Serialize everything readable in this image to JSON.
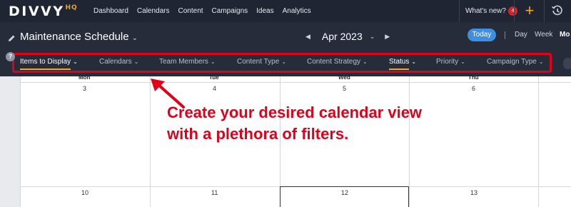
{
  "app": {
    "logo_text": "DIVVY",
    "logo_sup": "HQ"
  },
  "nav": {
    "links": [
      "Dashboard",
      "Calendars",
      "Content",
      "Campaigns",
      "Ideas",
      "Analytics"
    ],
    "whats_new": "What's new?",
    "whats_new_count": "4",
    "plus_icon": "plus-icon",
    "history_icon": "history-icon"
  },
  "header": {
    "board_title": "Maintenance Schedule",
    "month": "Apr 2023",
    "today_label": "Today",
    "views": [
      "Day",
      "Week",
      "Mo"
    ],
    "separator": "|"
  },
  "filters": [
    {
      "label": "Items to Display",
      "active": true
    },
    {
      "label": "Calendars",
      "active": false
    },
    {
      "label": "Team Members",
      "active": false
    },
    {
      "label": "Content Type",
      "active": false
    },
    {
      "label": "Content Strategy",
      "active": false
    },
    {
      "label": "Status",
      "active": true
    },
    {
      "label": "Priority",
      "active": false
    },
    {
      "label": "Campaign Type",
      "active": false
    }
  ],
  "calendar": {
    "weekdays": [
      "Mon",
      "Tue",
      "Wed",
      "Thu"
    ],
    "week1": [
      "3",
      "4",
      "5",
      "6"
    ],
    "week2": [
      "10",
      "11",
      "12",
      "13"
    ]
  },
  "help_label": "?",
  "annotation": {
    "text": "Create your desired calendar view with a plethora of filters."
  },
  "colors": {
    "nav_bg": "#1f2532",
    "header_bg": "#262c3a",
    "accent_orange": "#f5a623",
    "today_blue": "#3d8fe0",
    "annotation_red": "#e0001a"
  }
}
